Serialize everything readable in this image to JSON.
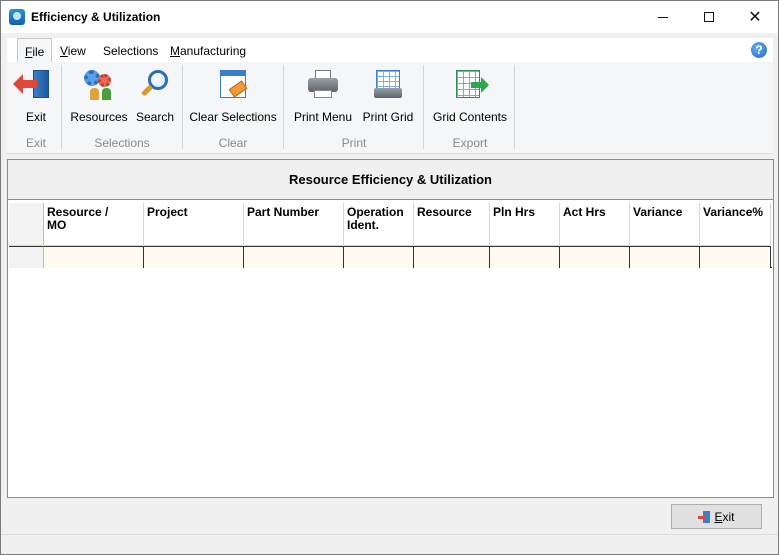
{
  "window": {
    "title": "Efficiency & Utilization"
  },
  "menu": {
    "items": [
      {
        "label": "File",
        "underline": "F",
        "rest": "ile"
      },
      {
        "label": "View",
        "underline": "V",
        "rest": "iew"
      },
      {
        "label": "Selections",
        "underline": "",
        "rest": "Selections"
      },
      {
        "label": "Manufacturing",
        "underline": "M",
        "rest": "anufacturing"
      }
    ],
    "help": "?"
  },
  "ribbon": {
    "buttons": {
      "exit": "Exit",
      "resources": "Resources",
      "search": "Search",
      "clear_selections": "Clear Selections",
      "print_menu": "Print Menu",
      "print_grid": "Print Grid",
      "grid_contents": "Grid Contents"
    },
    "groups": {
      "exit": "Exit",
      "selections": "Selections",
      "clear": "Clear",
      "print": "Print",
      "export": "Export"
    },
    "icons": {
      "exit": "exit-door-icon",
      "resources": "resources-gears-icon",
      "search": "magnifier-icon",
      "clear": "eraser-grid-icon",
      "print_menu": "printer-icon",
      "print_grid": "print-grid-icon",
      "grid_contents": "export-grid-icon"
    }
  },
  "panel": {
    "title": "Resource Efficiency & Utilization",
    "columns": [
      {
        "line1": "Resource /",
        "line2": "MO"
      },
      {
        "line1": "Project",
        "line2": ""
      },
      {
        "line1": "Part Number",
        "line2": ""
      },
      {
        "line1": "Operation",
        "line2": "Ident."
      },
      {
        "line1": "Resource",
        "line2": ""
      },
      {
        "line1": "Pln Hrs",
        "line2": ""
      },
      {
        "line1": "Act Hrs",
        "line2": ""
      },
      {
        "line1": "Variance",
        "line2": ""
      },
      {
        "line1": "Variance%",
        "line2": ""
      }
    ]
  },
  "footer": {
    "exit_prefix": "",
    "exit_underline": "E",
    "exit_rest": "xit"
  },
  "colors": {
    "row_bg": "#fffbf0",
    "accent": "#1c64c4"
  }
}
